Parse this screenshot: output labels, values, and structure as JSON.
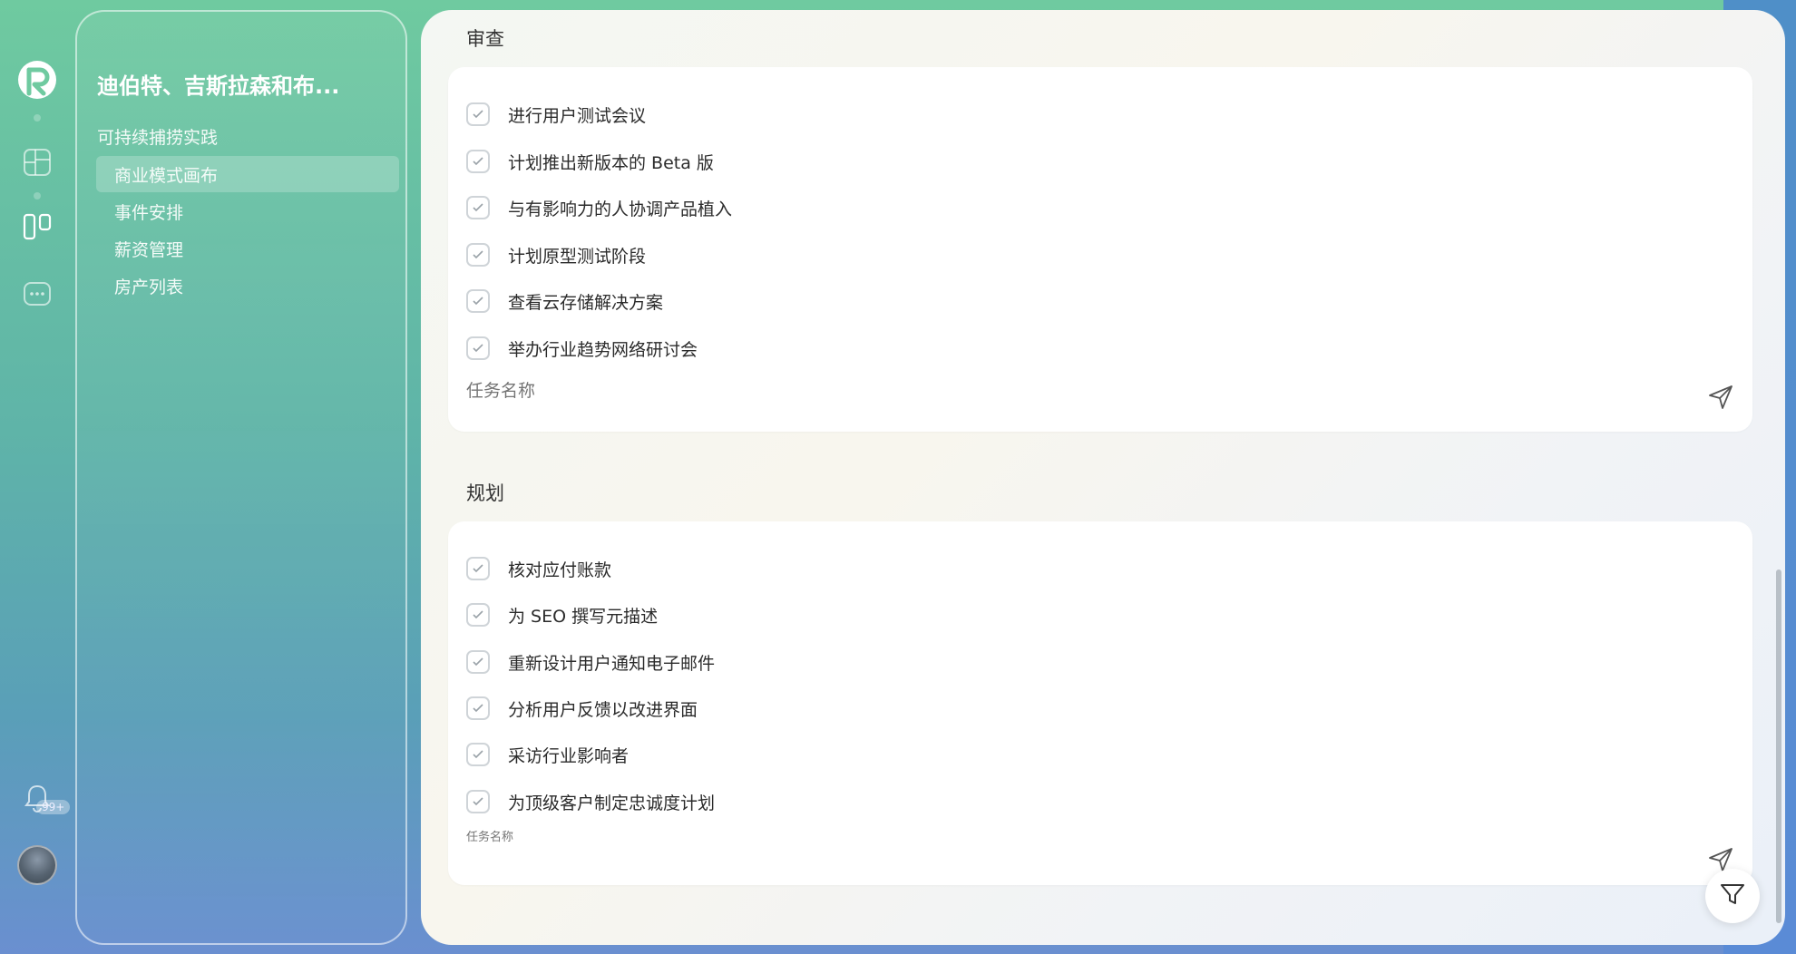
{
  "nav": {
    "project_title": "迪伯特、吉斯拉森和布...",
    "section": "可持续捕捞实践",
    "items": [
      {
        "label": "商业模式画布",
        "active": true
      },
      {
        "label": "事件安排",
        "active": false
      },
      {
        "label": "薪资管理",
        "active": false
      },
      {
        "label": "房产列表",
        "active": false
      }
    ]
  },
  "rail": {
    "icons": [
      "logo-icon",
      "dashboard-icon",
      "board-icon",
      "chat-icon",
      "bell-icon"
    ],
    "notification_badge": "99+"
  },
  "groups": [
    {
      "title": "审查",
      "tasks": [
        "进行用户测试会议",
        "计划推出新版本的 Beta 版",
        "与有影响力的人协调产品植入",
        "计划原型测试阶段",
        "查看云存储解决方案",
        "举办行业趋势网络研讨会"
      ],
      "input_placeholder": "任务名称"
    },
    {
      "title": "规划",
      "tasks": [
        "核对应付账款",
        "为 SEO 撰写元描述",
        "重新设计用户通知电子邮件",
        "分析用户反馈以改进界面",
        "采访行业影响者",
        "为顶级客户制定忠诚度计划"
      ],
      "input_placeholder": "任务名称"
    }
  ],
  "colors": {
    "accent_green": "#6fcaa0",
    "accent_blue": "#5a8bd6"
  }
}
